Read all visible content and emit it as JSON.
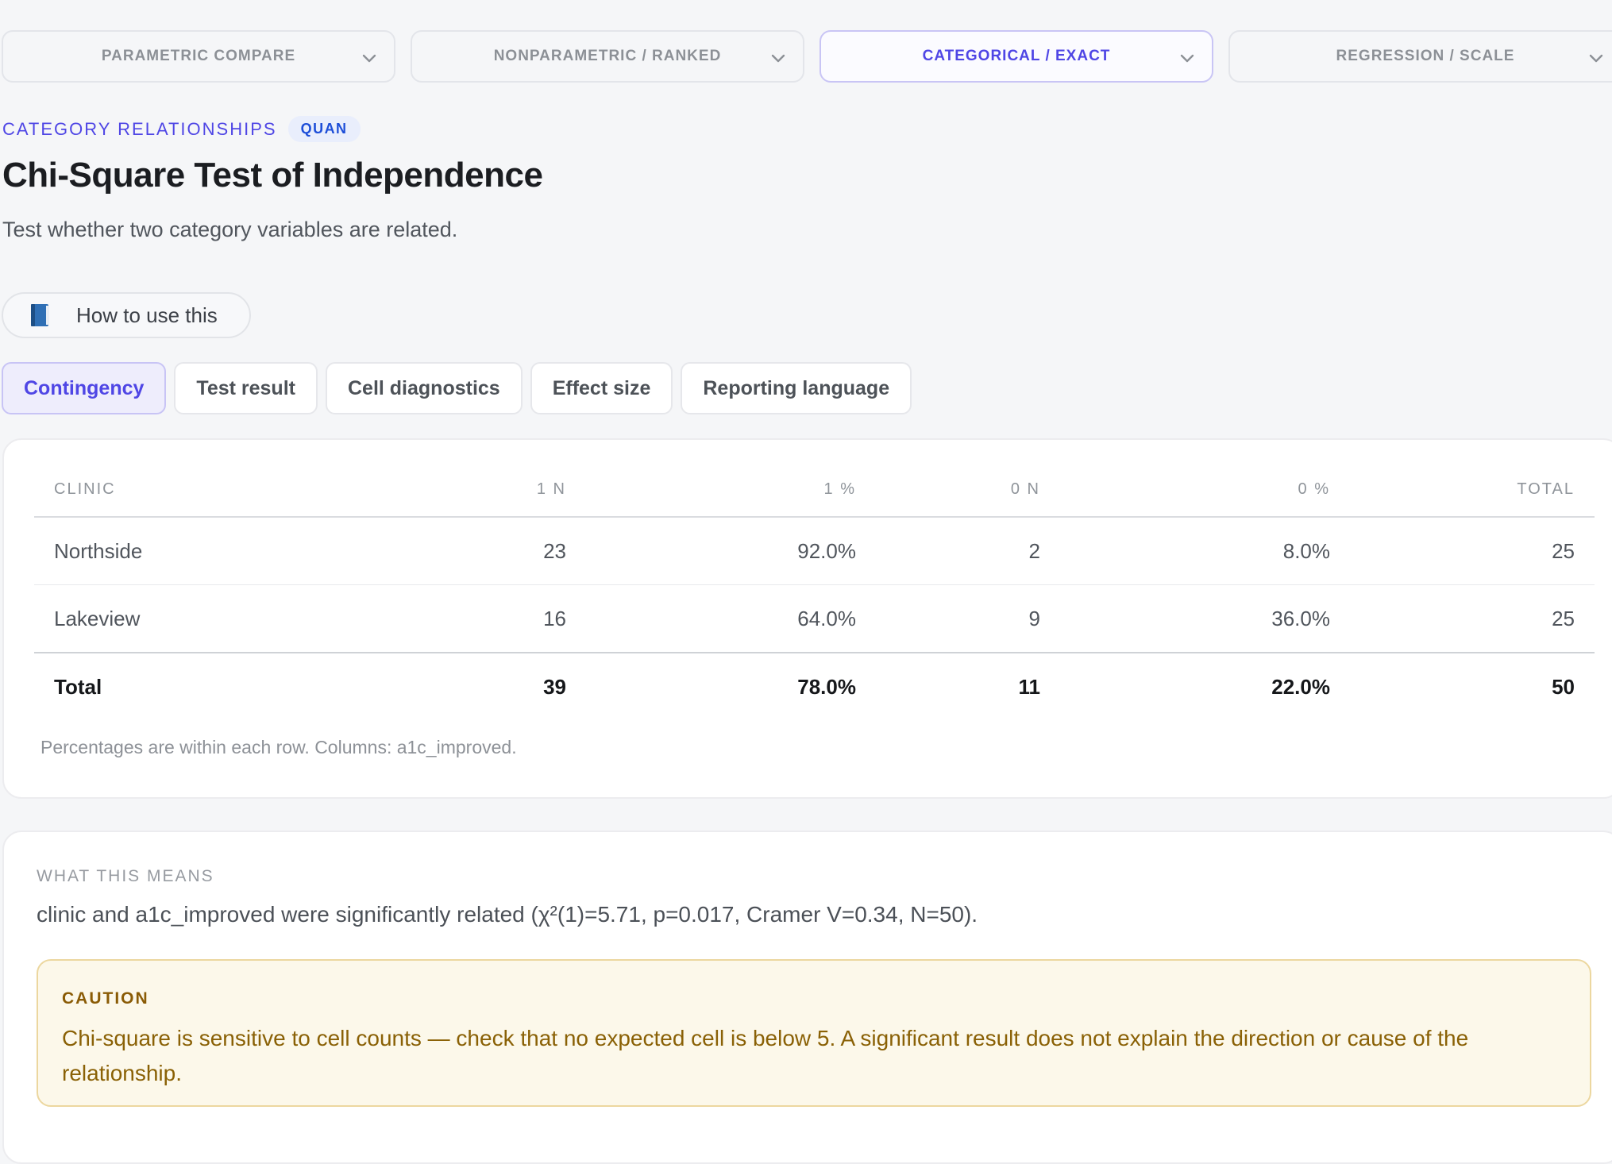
{
  "segments": [
    {
      "label": "PARAMETRIC COMPARE",
      "active": false
    },
    {
      "label": "NONPARAMETRIC / RANKED",
      "active": false
    },
    {
      "label": "CATEGORICAL / EXACT",
      "active": true
    },
    {
      "label": "REGRESSION / SCALE",
      "active": false
    }
  ],
  "header": {
    "eyebrow": "CATEGORY RELATIONSHIPS",
    "badge": "QUAN",
    "title": "Chi-Square Test of Independence",
    "subtitle": "Test whether two category variables are related."
  },
  "howto": {
    "icon": "book-icon",
    "label": "How to use this"
  },
  "tabs": [
    {
      "label": "Contingency",
      "active": true
    },
    {
      "label": "Test result",
      "active": false
    },
    {
      "label": "Cell diagnostics",
      "active": false
    },
    {
      "label": "Effect size",
      "active": false
    },
    {
      "label": "Reporting language",
      "active": false
    }
  ],
  "table": {
    "headers": [
      "CLINIC",
      "1 N",
      "1 %",
      "0 N",
      "0 %",
      "TOTAL"
    ],
    "rows": [
      [
        "Northside",
        "23",
        "92.0%",
        "2",
        "8.0%",
        "25"
      ],
      [
        "Lakeview",
        "16",
        "64.0%",
        "9",
        "36.0%",
        "25"
      ]
    ],
    "total": [
      "Total",
      "39",
      "78.0%",
      "11",
      "22.0%",
      "50"
    ],
    "note": "Percentages are within each row. Columns: a1c_improved."
  },
  "meaning": {
    "label": "WHAT THIS MEANS",
    "text": "clinic and a1c_improved were significantly related (χ²(1)=5.71, p=0.017, Cramer V=0.34, N=50).",
    "caution_label": "CAUTION",
    "caution_text": "Chi-square is sensitive to cell counts — check that no expected cell is below 5. A significant result does not explain the direction or cause of the relationship."
  },
  "colors": {
    "accent": "#4f46e5",
    "caution_bg": "#fcf8ea",
    "caution_text": "#8a6106"
  }
}
